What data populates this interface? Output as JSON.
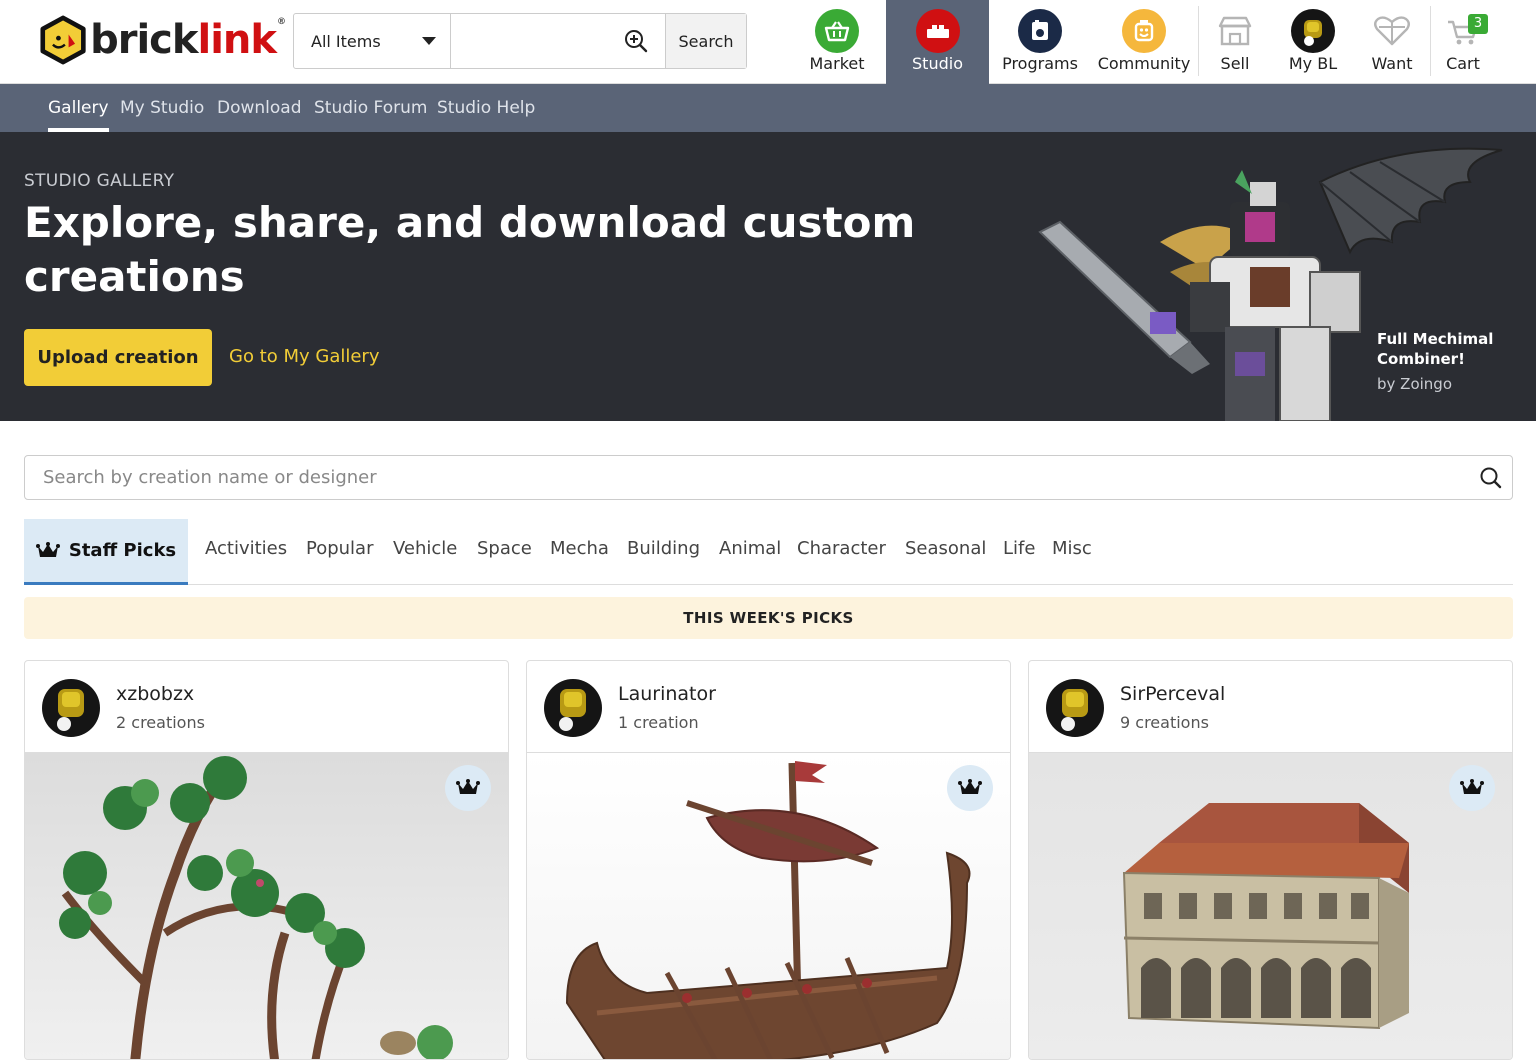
{
  "header": {
    "logo_text_a": "brick",
    "logo_text_b": "link",
    "logo_reg": "®",
    "search": {
      "category": "All Items",
      "value": "",
      "placeholder": "",
      "button": "Search"
    },
    "nav": [
      {
        "label": "Market",
        "icon": "basket-icon",
        "color": "#3aaa35"
      },
      {
        "label": "Studio",
        "icon": "brick-icon",
        "color": "#d01012"
      },
      {
        "label": "Programs",
        "icon": "programs-icon",
        "color": "#1b2a47"
      },
      {
        "label": "Community",
        "icon": "minifig-face-icon",
        "color": "#f5b73c"
      },
      {
        "label": "Sell",
        "icon": "store-icon",
        "color": "#b5b5b5"
      },
      {
        "label": "My BL",
        "icon": "avatar-icon",
        "color": "#151515"
      },
      {
        "label": "Want",
        "icon": "heart-icon",
        "color": "#b5b5b5"
      },
      {
        "label": "Cart",
        "icon": "cart-icon",
        "color": "#b5b5b5",
        "badge": "3"
      }
    ]
  },
  "subnav": {
    "items": [
      "Gallery",
      "My Studio",
      "Download",
      "Studio Forum",
      "Studio Help"
    ]
  },
  "hero": {
    "kicker": "STUDIO GALLERY",
    "title": "Explore, share, and download custom creations",
    "upload_label": "Upload creation",
    "gallery_link": "Go to My Gallery",
    "caption_title": "Full Mechimal Combiner!",
    "caption_by": "by Zoingo"
  },
  "gallery_search": {
    "placeholder": "Search by creation name or designer",
    "value": ""
  },
  "tabs": [
    "Staff Picks",
    "Activities",
    "Popular",
    "Vehicle",
    "Space",
    "Mecha",
    "Building",
    "Animal",
    "Character",
    "Seasonal",
    "Life",
    "Misc"
  ],
  "picks_banner": "THIS WEEK'S PICKS",
  "cards": [
    {
      "user": "xzbobzx",
      "count": "2 creations"
    },
    {
      "user": "Laurinator",
      "count": "1 creation"
    },
    {
      "user": "SirPerceval",
      "count": "9 creations"
    }
  ],
  "colors": {
    "accent_yellow": "#f2cd37",
    "subnav_bg": "#5a6477",
    "hero_bg": "#2b2d33",
    "tab_active_bg": "#dceaf5"
  }
}
